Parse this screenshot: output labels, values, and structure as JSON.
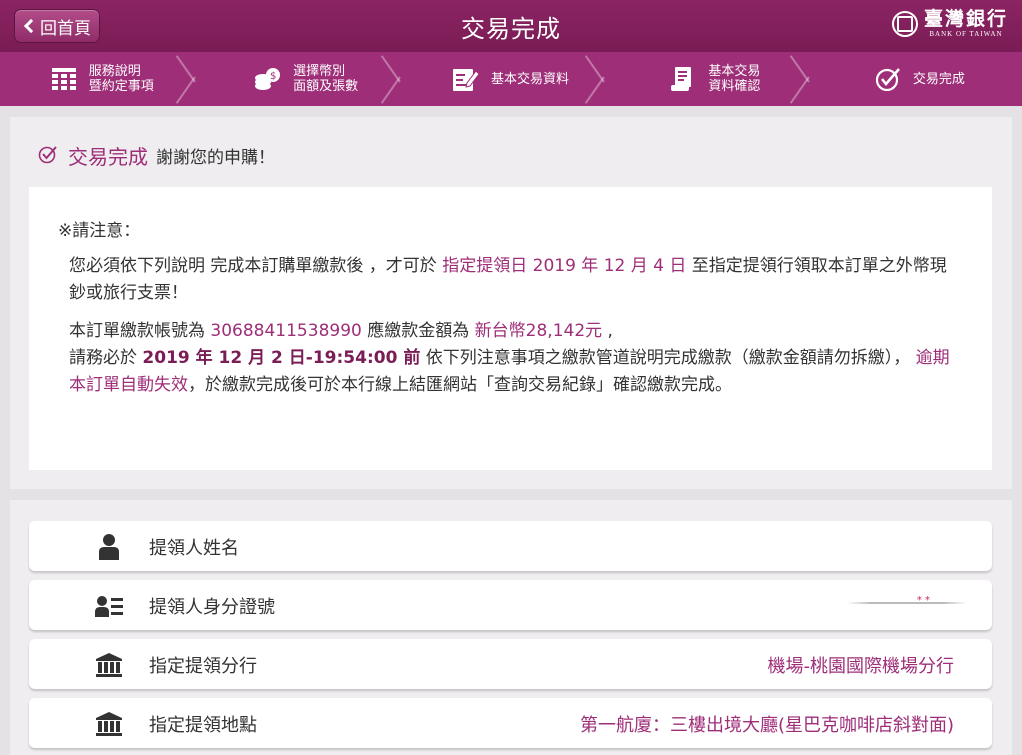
{
  "header": {
    "back_label": "回首頁",
    "title": "交易完成",
    "logo_cn": "臺灣銀行",
    "logo_en": "BANK OF TAIWAN"
  },
  "steps": [
    {
      "line1": "服務說明",
      "line2": "暨約定事項",
      "icon": "grid-icon"
    },
    {
      "line1": "選擇幣別",
      "line2": "面額及張數",
      "icon": "coins-icon"
    },
    {
      "line1": "基本交易資料",
      "line2": "",
      "icon": "form-edit-icon"
    },
    {
      "line1": "基本交易",
      "line2": "資料確認",
      "icon": "document-confirm-icon"
    },
    {
      "line1": "交易完成",
      "line2": "",
      "icon": "check-circle-icon"
    }
  ],
  "completion": {
    "title": "交易完成",
    "thanks": "謝謝您的申購！"
  },
  "notice": {
    "title": "※請注意：",
    "p1_a": "您必須依下列說明 完成本訂購單繳款後 ，才可於 ",
    "p1_hl": "指定提領日 2019 年 12 月 4 日",
    "p1_b": " 至指定提領行領取本訂單之外幣現鈔或旅行支票！",
    "p2_a": "本訂單繳款帳號為 ",
    "p2_account": "30688411538990",
    "p2_b": " 應繳款金額為 ",
    "p2_amount": "新台幣28,142元",
    "p2_c": " ,",
    "p2_d": "請務必於 ",
    "p2_deadline": "2019 年 12 月 2 日-19:54:00 前",
    "p2_e": " 依下列注意事項之繳款管道說明完成繳款（繳款金額請勿拆繳），",
    "p2_expire": " 逾期本訂單自動失效",
    "p2_f": "，於繳款完成後可於本行線上結匯網站「查詢交易紀錄」確認繳款完成。"
  },
  "details": [
    {
      "label": "提領人姓名",
      "value": "",
      "icon": "person-icon"
    },
    {
      "label": "提領人身分證號",
      "value": "",
      "icon": "id-card-icon"
    },
    {
      "label": "指定提領分行",
      "value": "機場-桃園國際機場分行",
      "icon": "bank-icon"
    },
    {
      "label": "指定提領地點",
      "value": "第一航廈：三樓出境大廳(星巴克咖啡店斜對面)",
      "icon": "bank-icon"
    }
  ]
}
